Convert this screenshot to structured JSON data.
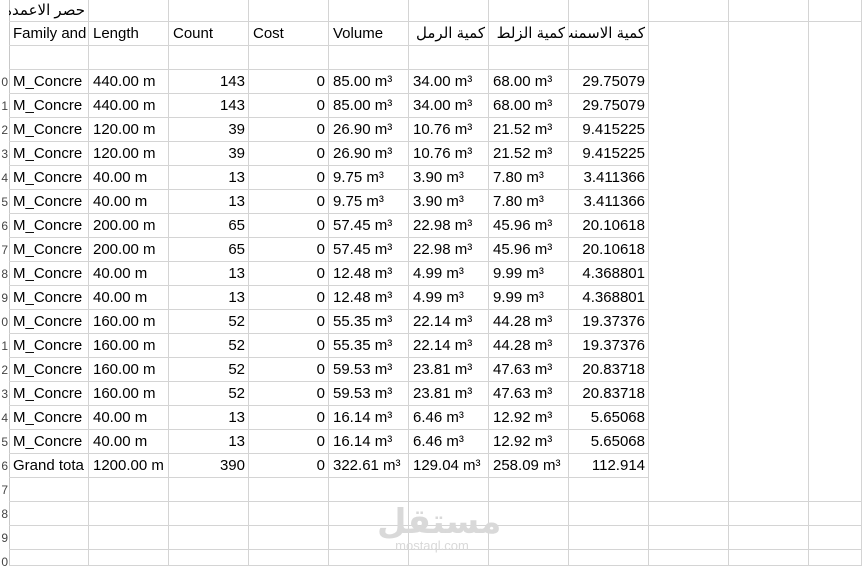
{
  "sheet_title": "حصر الاعمدة",
  "headers": [
    "Family and",
    "Length",
    "Count",
    "Cost",
    "Volume",
    "كمية الرمل",
    "كمية الزلط",
    "كمية الاسمنت"
  ],
  "rows": [
    [
      "M_Concre",
      "440.00 m",
      "143",
      "0",
      "85.00 m³",
      "34.00 m³",
      "68.00 m³",
      "29.75079"
    ],
    [
      "M_Concre",
      "440.00 m",
      "143",
      "0",
      "85.00 m³",
      "34.00 m³",
      "68.00 m³",
      "29.75079"
    ],
    [
      "M_Concre",
      "120.00 m",
      "39",
      "0",
      "26.90 m³",
      "10.76 m³",
      "21.52 m³",
      "9.415225"
    ],
    [
      "M_Concre",
      "120.00 m",
      "39",
      "0",
      "26.90 m³",
      "10.76 m³",
      "21.52 m³",
      "9.415225"
    ],
    [
      "M_Concre",
      "40.00 m",
      "13",
      "0",
      "9.75 m³",
      "3.90 m³",
      "7.80 m³",
      "3.411366"
    ],
    [
      "M_Concre",
      "40.00 m",
      "13",
      "0",
      "9.75 m³",
      "3.90 m³",
      "7.80 m³",
      "3.411366"
    ],
    [
      "M_Concre",
      "200.00 m",
      "65",
      "0",
      "57.45 m³",
      "22.98 m³",
      "45.96 m³",
      "20.10618"
    ],
    [
      "M_Concre",
      "200.00 m",
      "65",
      "0",
      "57.45 m³",
      "22.98 m³",
      "45.96 m³",
      "20.10618"
    ],
    [
      "M_Concre",
      "40.00 m",
      "13",
      "0",
      "12.48 m³",
      "4.99 m³",
      "9.99 m³",
      "4.368801"
    ],
    [
      "M_Concre",
      "40.00 m",
      "13",
      "0",
      "12.48 m³",
      "4.99 m³",
      "9.99 m³",
      "4.368801"
    ],
    [
      "M_Concre",
      "160.00 m",
      "52",
      "0",
      "55.35 m³",
      "22.14 m³",
      "44.28 m³",
      "19.37376"
    ],
    [
      "M_Concre",
      "160.00 m",
      "52",
      "0",
      "55.35 m³",
      "22.14 m³",
      "44.28 m³",
      "19.37376"
    ],
    [
      "M_Concre",
      "160.00 m",
      "52",
      "0",
      "59.53 m³",
      "23.81 m³",
      "47.63 m³",
      "20.83718"
    ],
    [
      "M_Concre",
      "160.00 m",
      "52",
      "0",
      "59.53 m³",
      "23.81 m³",
      "47.63 m³",
      "20.83718"
    ],
    [
      "M_Concre",
      "40.00 m",
      "13",
      "0",
      "16.14 m³",
      "6.46 m³",
      "12.92 m³",
      "5.65068"
    ],
    [
      "M_Concre",
      "40.00 m",
      "13",
      "0",
      "16.14 m³",
      "6.46 m³",
      "12.92 m³",
      "5.65068"
    ]
  ],
  "total_row": [
    "Grand tota",
    "1200.00 m",
    "390",
    "0",
    "322.61 m³",
    "129.04 m³",
    "258.09 m³",
    "112.914"
  ],
  "row_header_fragments": [
    "0",
    "1",
    "2",
    "3",
    "4",
    "5",
    "6",
    "7",
    "8",
    "9",
    "0",
    "1",
    "2",
    "3",
    "4",
    "5",
    "6",
    "7",
    "8",
    "9",
    "0"
  ],
  "watermark": {
    "main": "مستقل",
    "sub": "mostaql.com"
  },
  "colors": {
    "gridline": "#d4d4d4",
    "watermark": "#d9d9d9"
  }
}
